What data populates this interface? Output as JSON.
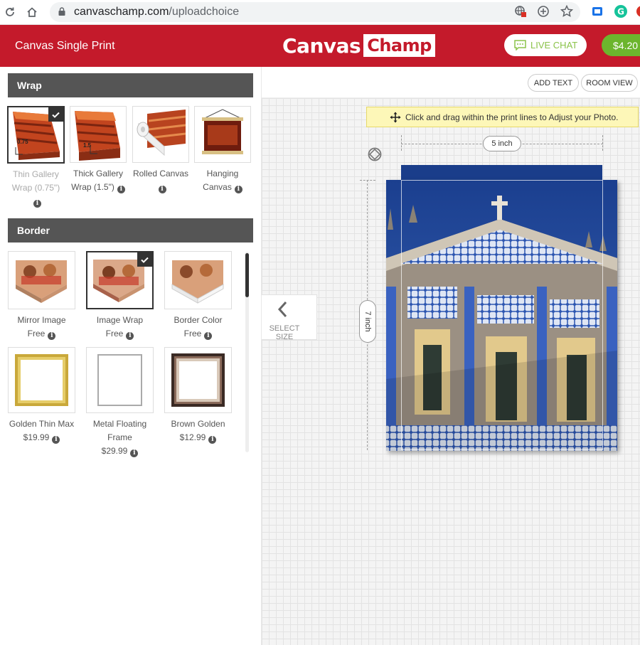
{
  "browser": {
    "url_domain": "canvaschamp.com",
    "url_path": "/uploadchoice"
  },
  "header": {
    "site_title": "Canvas Single Print",
    "logo_word1": "Canvas",
    "logo_word2": "Champ",
    "live_chat": "LIVE CHAT",
    "price": "$4.20"
  },
  "wrap": {
    "heading": "Wrap",
    "options": [
      {
        "line1": "Thin Gallery",
        "line2": "Wrap (0.75\")",
        "thumb_label": "0.75",
        "selected": true
      },
      {
        "line1": "Thick Gallery",
        "line2": "Wrap (1.5\")",
        "thumb_label": "1.5",
        "selected": false
      },
      {
        "line1": "Rolled Canvas",
        "line2": "",
        "selected": false
      },
      {
        "line1": "Hanging",
        "line2": "Canvas",
        "selected": false
      }
    ]
  },
  "border": {
    "heading": "Border",
    "options": [
      {
        "line1": "Mirror Image",
        "line2": "Free",
        "selected": false
      },
      {
        "line1": "Image Wrap",
        "line2": "Free",
        "selected": true
      },
      {
        "line1": "Border Color",
        "line2": "Free",
        "selected": false
      },
      {
        "line1": "Golden Thin Max",
        "line2": "$19.99",
        "selected": false
      },
      {
        "line1": "Metal Floating",
        "line2": "Frame",
        "line3": "$29.99",
        "selected": false
      },
      {
        "line1": "Brown Golden",
        "line2": "$12.99",
        "selected": false
      }
    ]
  },
  "toolbar": {
    "add_text": "ADD TEXT",
    "room_view": "ROOM VIEW"
  },
  "editor": {
    "hint": "Click and drag within the print lines to Adjust your Photo.",
    "width_label": "5 inch",
    "height_label": "7 inch",
    "select_size": "SELECT SIZE"
  },
  "colors": {
    "brand_red": "#c41a2b",
    "chat_green": "#8bc34a",
    "price_green": "#6cb52d"
  }
}
